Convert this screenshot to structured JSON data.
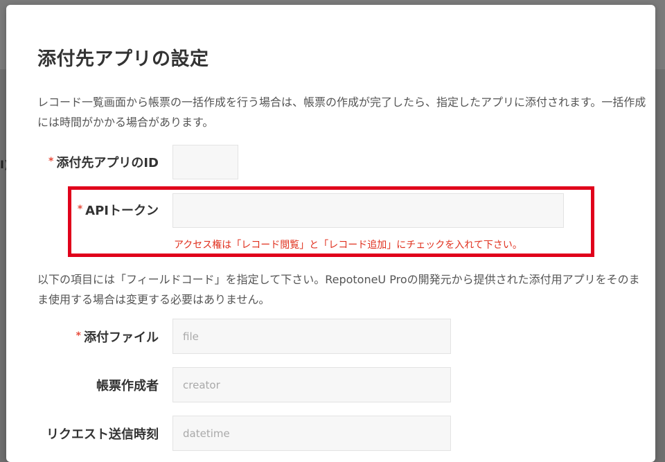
{
  "dialog": {
    "title": "添付先アプリの設定",
    "description": "レコード一覧画面から帳票の一括作成を行う場合は、帳票の作成が完了したら、指定したアプリに添付されます。一括作成には時間がかかる場合があります。",
    "field_description": "以下の項目には「フィールドコード」を指定して下さい。RepotoneU Proの開発元から提供された添付用アプリをそのまま使用する場合は変更する必要はありません。"
  },
  "form": {
    "required_mark": "*",
    "app_id": {
      "label": "添付先アプリのID",
      "value": ""
    },
    "api_token": {
      "label": "APIトークン",
      "value": "",
      "hint": "アクセス権は「レコード閲覧」と「レコード追加」にチェックを入れて下さい。"
    },
    "attachment_file": {
      "label": "添付ファイル",
      "placeholder": "file"
    },
    "creator": {
      "label": "帳票作成者",
      "placeholder": "creator"
    },
    "request_time": {
      "label": "リクエスト送信時刻",
      "placeholder": "datetime"
    }
  },
  "background": {
    "partial_text": "I)"
  },
  "colors": {
    "highlight": "#e0001b",
    "required": "#e74c3c",
    "hint": "#e0301e"
  }
}
